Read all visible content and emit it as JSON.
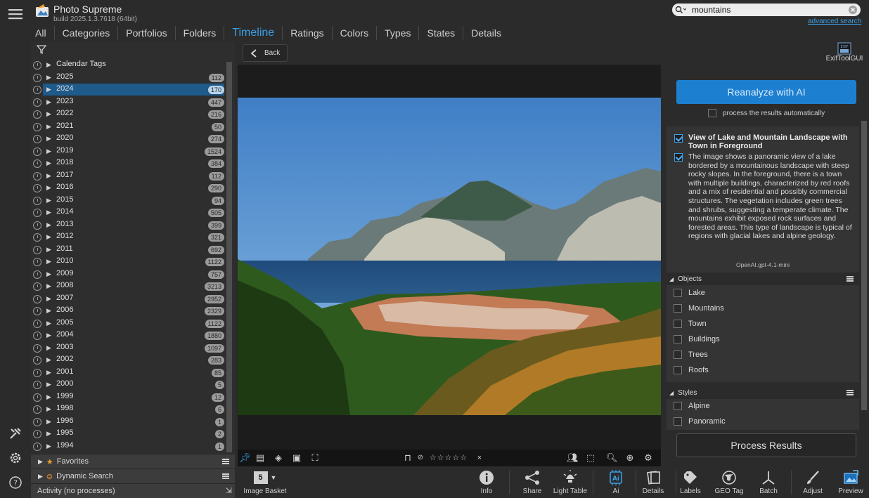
{
  "app": {
    "title": "Photo Supreme",
    "build": "build 2025.1.3.7618 (64bit)"
  },
  "nav": {
    "tabs": [
      "All",
      "Categories",
      "Portfolios",
      "Folders",
      "Timeline",
      "Ratings",
      "Colors",
      "Types",
      "States",
      "Details"
    ],
    "active": "Timeline"
  },
  "search": {
    "value": "mountains",
    "advanced_label": "advanced search"
  },
  "exif_tool": {
    "label": "ExifToolGUI",
    "icon_text": "EXIF"
  },
  "timeline": {
    "root_label": "Calendar Tags",
    "selected": "2024",
    "years": [
      {
        "year": "2025",
        "count": "112"
      },
      {
        "year": "2024",
        "count": "170"
      },
      {
        "year": "2023",
        "count": "447"
      },
      {
        "year": "2022",
        "count": "216"
      },
      {
        "year": "2021",
        "count": "50"
      },
      {
        "year": "2020",
        "count": "274"
      },
      {
        "year": "2019",
        "count": "1524"
      },
      {
        "year": "2018",
        "count": "384"
      },
      {
        "year": "2017",
        "count": "112"
      },
      {
        "year": "2016",
        "count": "290"
      },
      {
        "year": "2015",
        "count": "94"
      },
      {
        "year": "2014",
        "count": "505"
      },
      {
        "year": "2013",
        "count": "399"
      },
      {
        "year": "2012",
        "count": "321"
      },
      {
        "year": "2011",
        "count": "692"
      },
      {
        "year": "2010",
        "count": "1122"
      },
      {
        "year": "2009",
        "count": "757"
      },
      {
        "year": "2008",
        "count": "3213"
      },
      {
        "year": "2007",
        "count": "2952"
      },
      {
        "year": "2006",
        "count": "2329"
      },
      {
        "year": "2005",
        "count": "1122"
      },
      {
        "year": "2004",
        "count": "1880"
      },
      {
        "year": "2003",
        "count": "1097"
      },
      {
        "year": "2002",
        "count": "283"
      },
      {
        "year": "2001",
        "count": "85"
      },
      {
        "year": "2000",
        "count": "5"
      },
      {
        "year": "1999",
        "count": "12"
      },
      {
        "year": "1998",
        "count": "6"
      },
      {
        "year": "1996",
        "count": "1"
      },
      {
        "year": "1995",
        "count": "2"
      },
      {
        "year": "1994",
        "count": "1"
      }
    ]
  },
  "panels": {
    "favorites": "Favorites",
    "dynamic_search": "Dynamic Search",
    "activity": "Activity (no processes)"
  },
  "viewer": {
    "back_label": "Back"
  },
  "basket": {
    "count": "5",
    "label": "Image Basket"
  },
  "toolbar": [
    "Info",
    "Share",
    "Light Table",
    "Ai",
    "Details",
    "Labels",
    "GEO Tag",
    "Batch",
    "Adjust",
    "Preview"
  ],
  "ai": {
    "reanalyze_label": "Reanalyze with AI",
    "auto_process_label": "process the results automatically",
    "title": "View of Lake and Mountain Landscape with Town in Foreground",
    "description": "The image shows a panoramic view of a lake bordered by a mountainous landscape with steep rocky slopes. In the foreground, there is a town with multiple buildings, characterized by red roofs and a mix of residential and possibly commercial structures. The vegetation includes green trees and shrubs, suggesting a temperate climate. The mountains exhibit exposed rock surfaces and forested areas. This type of landscape is typical of regions with glacial lakes and alpine geology.",
    "model": "OpenAI.gpt-4.1-mini",
    "objects_header": "Objects",
    "objects": [
      "Lake",
      "Mountains",
      "Town",
      "Buildings",
      "Trees",
      "Roofs"
    ],
    "styles_header": "Styles",
    "styles": [
      "Alpine",
      "Panoramic"
    ],
    "process_label": "Process Results"
  },
  "colors": {
    "accent": "#3aa0e8",
    "selection": "#1e5a8a",
    "button": "#1d7fd0"
  }
}
